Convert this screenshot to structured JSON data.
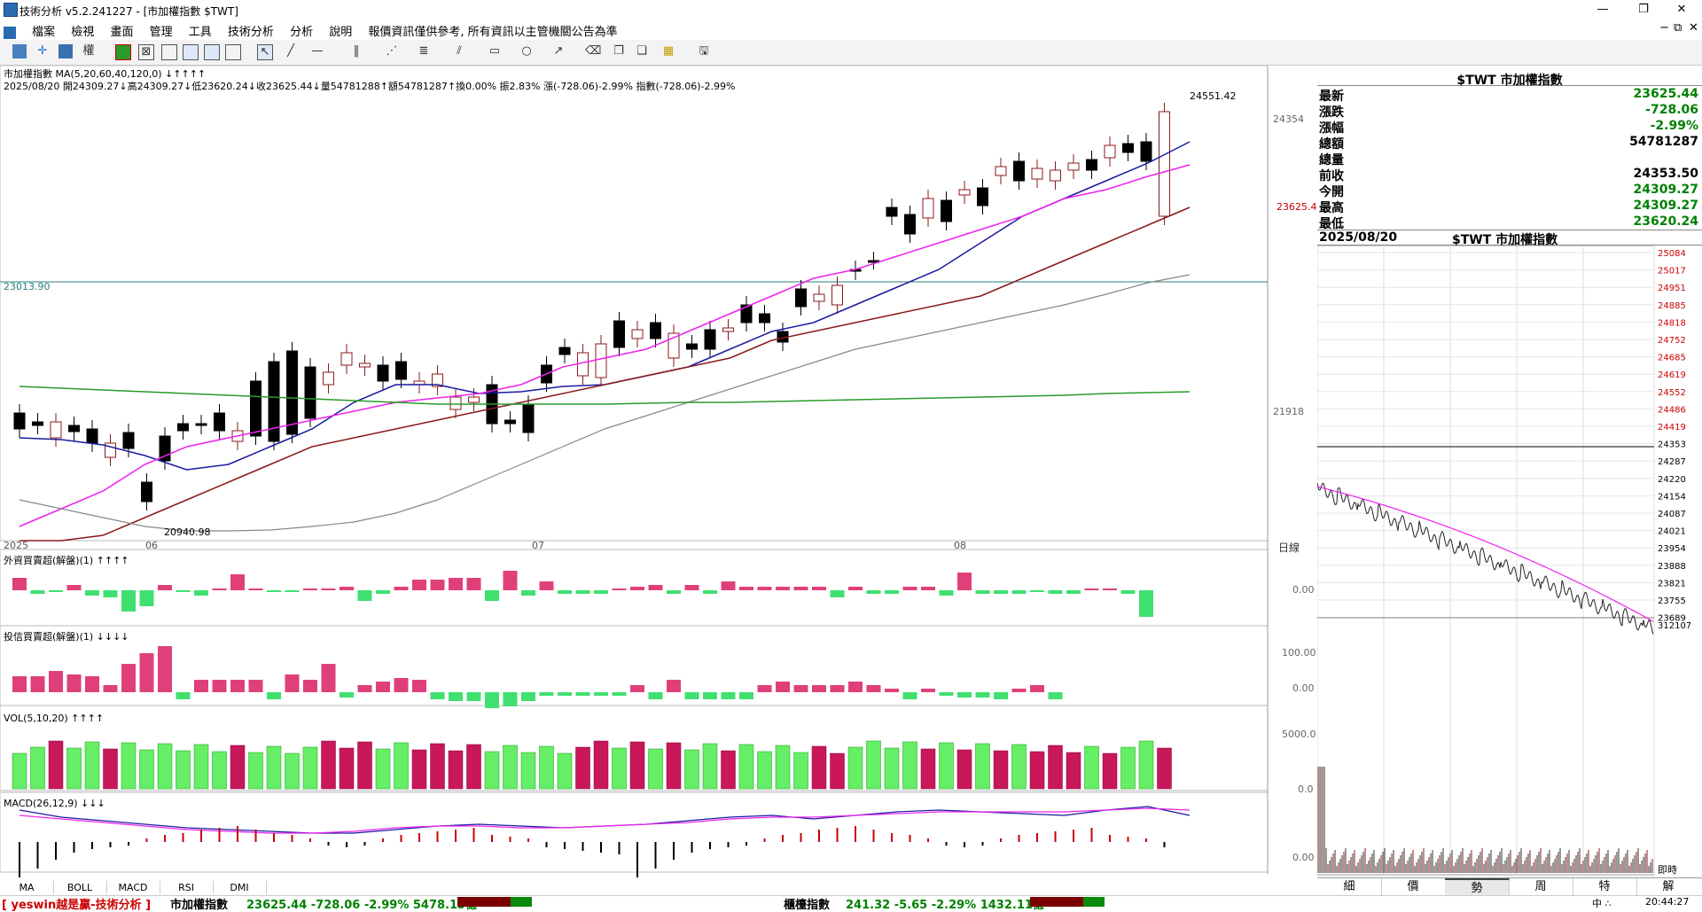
{
  "window": {
    "title": "技術分析 v5.2.241227 - [市加權指數 $TWT]",
    "controls": [
      "—",
      "❐",
      "✕"
    ],
    "inner_controls": [
      "−",
      "⧉",
      "✕"
    ]
  },
  "menu": [
    "檔案",
    "檢視",
    "畫面",
    "管理",
    "工具",
    "技術分析",
    "分析",
    "說明",
    "報價資訊僅供參考, 所有資訊以主管機關公告為準"
  ],
  "chart": {
    "header_line1": "市加權指數 MA(5,20,60,40,120,0) ↓↑↑↑↑",
    "header_line2": "2025/08/20 開24309.27↓高24309.27↓低23620.24↓收23625.44↓量54781288↑額54781287↑換0.00% 振2.83% 漲(-728.06)-2.99% 指數(-728.06)-2.99%",
    "high_label": "24551.42",
    "low_label": "20940.98",
    "hline_label": "23013.90",
    "price_ticks": [
      "24354",
      "23625.4",
      "21918"
    ],
    "x_labels": [
      "2025",
      "06",
      "07",
      "08"
    ],
    "day_label": "日線",
    "panel_foreign": {
      "title": "外資買賣超(解盤)(1) ↑↑↑↑",
      "ticks": [
        "0.00"
      ]
    },
    "panel_trust": {
      "title": "投信買賣超(解盤)(1) ↓↓↓↓",
      "ticks": [
        "100.00",
        "0.00"
      ]
    },
    "panel_vol": {
      "title": "VOL(5,10,20) ↑↑↑↑",
      "ticks": [
        "5000.0",
        "0.0"
      ]
    },
    "panel_macd": {
      "title": "MACD(26,12,9) ↓↓↓",
      "ticks": [
        "0.00"
      ]
    },
    "colors": {
      "up": "#e0407a",
      "down": "#40e070",
      "ma5": "#1a1aa0",
      "ma20": "#ee22ee",
      "ma60": "#8b1a1a",
      "ma120": "#888888",
      "ma240": "#2a9a2a"
    }
  },
  "bottom_tabs": [
    "MA",
    "BOLL",
    "MACD",
    "RSI",
    "DMI"
  ],
  "quote": {
    "title": "$TWT 市加權指數",
    "rows": [
      {
        "label": "最新",
        "value": "23625.44",
        "color": "#008000"
      },
      {
        "label": "漲跌",
        "value": "-728.06",
        "color": "#008000"
      },
      {
        "label": "漲幅",
        "value": "-2.99%",
        "color": "#008000"
      },
      {
        "label": "總額",
        "value": "54781287",
        "color": "#000000"
      },
      {
        "label": "總量",
        "value": "",
        "color": "#000000"
      },
      {
        "label": "前收",
        "value": "24353.50",
        "color": "#000000"
      },
      {
        "label": "今開",
        "value": "24309.27",
        "color": "#008000"
      },
      {
        "label": "最高",
        "value": "24309.27",
        "color": "#008000"
      },
      {
        "label": "最低",
        "value": "23620.24",
        "color": "#008000"
      }
    ]
  },
  "intraday": {
    "date": "2025/08/20",
    "title": "$TWT 市加權指數",
    "ticks": [
      "25084",
      "25017",
      "24951",
      "24885",
      "24818",
      "24752",
      "24685",
      "24619",
      "24552",
      "24486",
      "24419",
      "24353",
      "24287",
      "24220",
      "24154",
      "24087",
      "24021",
      "23954",
      "23888",
      "23821",
      "23755",
      "23689"
    ],
    "vol_max": "312107",
    "time_label": "即時"
  },
  "right_tabs": [
    "細",
    "價",
    "勢",
    "周",
    "特",
    "解"
  ],
  "status": {
    "left": "[ yeswin越是贏-技術分析 ]",
    "index1": "市加權指數",
    "index1_vals": "23625.44 -728.06 -2.99% 5478.13億",
    "index2": "櫃檯指數",
    "index2_vals": "241.32 -5.65 -2.29% 1432.11億",
    "time": "20:44:27",
    "ime": "中 ∴"
  }
}
